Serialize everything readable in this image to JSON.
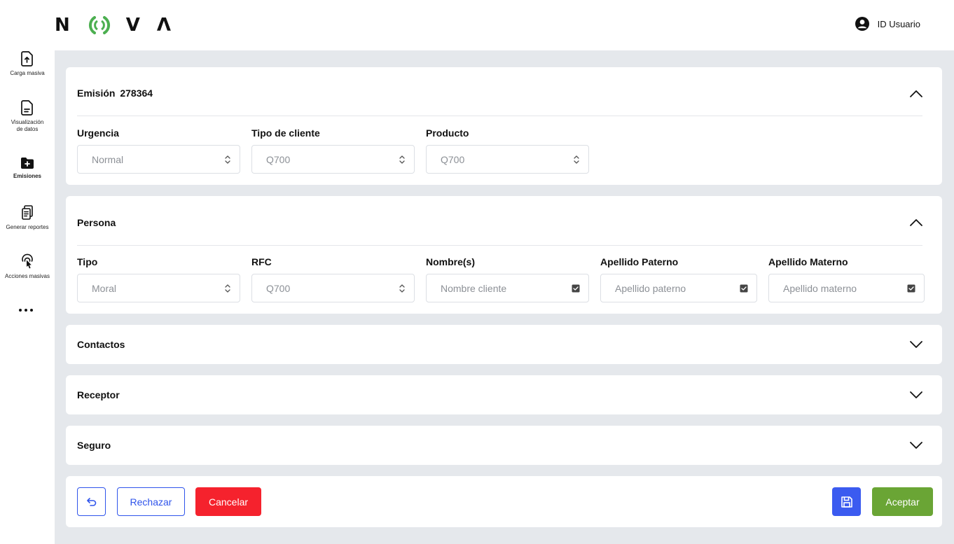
{
  "brand": {
    "letters": [
      "N",
      "V",
      "Λ"
    ],
    "accent": "#4caf50"
  },
  "user": {
    "label": "ID Usuario",
    "icon": "user-circle-icon"
  },
  "sidebar": {
    "items": [
      {
        "label": "Carga masiva",
        "icon": "upload-file-icon"
      },
      {
        "label": "Visualización",
        "label2": "de datos",
        "icon": "document-icon"
      },
      {
        "label": "Emisiones",
        "icon": "folder-add-icon",
        "active": true
      },
      {
        "label": "Generar reportes",
        "icon": "reports-icon"
      },
      {
        "label": "Acciones masivas",
        "icon": "touch-icon"
      }
    ],
    "more_icon": "more-dots-icon"
  },
  "emision": {
    "title_prefix": "Emisión",
    "number": "278364",
    "fields": [
      {
        "label": "Urgencia",
        "value": "Normal",
        "kind": "select"
      },
      {
        "label": "Tipo de cliente",
        "value": "Q700",
        "kind": "select"
      },
      {
        "label": "Producto",
        "value": "Q700",
        "kind": "select"
      }
    ]
  },
  "persona": {
    "title": "Persona",
    "fields": [
      {
        "label": "Tipo",
        "value": "Moral",
        "kind": "select"
      },
      {
        "label": "RFC",
        "value": "Q700",
        "kind": "select"
      },
      {
        "label": "Nombre(s)",
        "placeholder": "Nombre cliente",
        "kind": "text"
      },
      {
        "label": "Apellido Paterno",
        "placeholder": "Apellido paterno",
        "kind": "text"
      },
      {
        "label": "Apellido Materno",
        "placeholder": "Apellido materno",
        "kind": "text"
      }
    ]
  },
  "sections": [
    {
      "title": "Contactos"
    },
    {
      "title": "Receptor"
    },
    {
      "title": "Seguro"
    }
  ],
  "actions": {
    "undo_icon": "undo-icon",
    "reject": "Rechazar",
    "cancel": "Cancelar",
    "save_icon": "save-icon",
    "accept": "Aceptar",
    "colors": {
      "blue": "#2f54eb",
      "red": "#f5222d",
      "green": "#6aa535",
      "save": "#3b5bf0"
    }
  }
}
